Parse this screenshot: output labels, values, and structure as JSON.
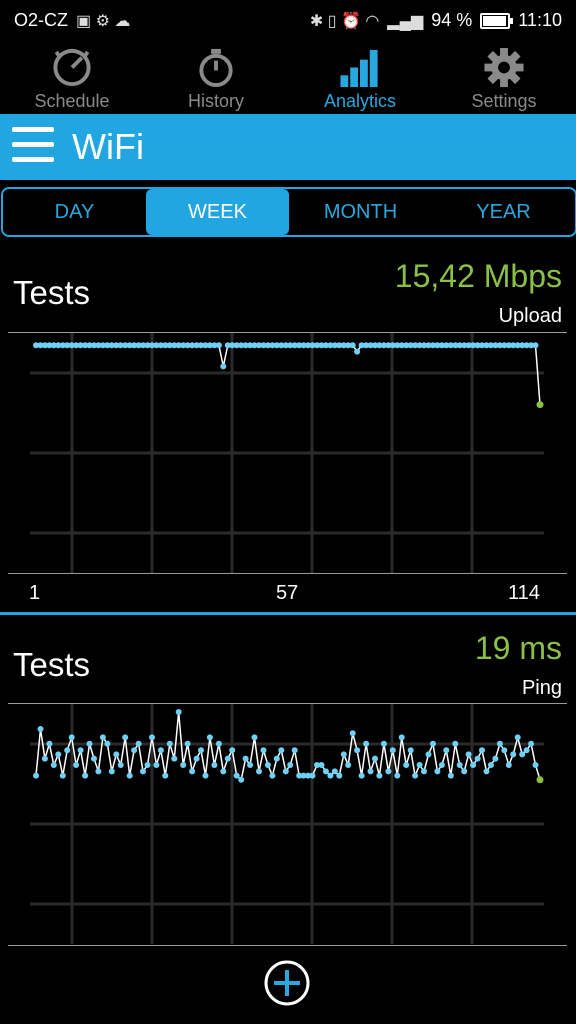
{
  "status_bar": {
    "carrier": "O2-CZ",
    "battery_pct": "94 %",
    "time": "11:10"
  },
  "tabs": [
    {
      "label": "Schedule",
      "icon": "schedule-icon"
    },
    {
      "label": "History",
      "icon": "stopwatch-icon"
    },
    {
      "label": "Analytics",
      "icon": "bar-chart-icon",
      "active": true
    },
    {
      "label": "Settings",
      "icon": "gear-icon"
    }
  ],
  "header": {
    "title": "WiFi"
  },
  "periods": [
    {
      "label": "DAY"
    },
    {
      "label": "WEEK",
      "selected": true
    },
    {
      "label": "MONTH"
    },
    {
      "label": "YEAR"
    }
  ],
  "upload_panel": {
    "title": "Tests",
    "value": "15,42 Mbps",
    "subtitle": "Upload",
    "x_ticks": [
      "1",
      "57",
      "114"
    ]
  },
  "ping_panel": {
    "title": "Tests",
    "value": "19 ms",
    "subtitle": "Ping"
  },
  "colors": {
    "accent": "#22a6e1",
    "value_green": "#8ac046",
    "point": "#6fd0f5"
  },
  "chart_data": [
    {
      "type": "line",
      "series": [
        {
          "values": [
            2,
            2,
            2,
            2,
            2,
            2,
            2,
            2,
            2,
            2,
            2,
            2,
            2,
            2,
            2,
            2,
            2,
            2,
            2,
            2,
            2,
            2,
            2,
            2,
            2,
            2,
            2,
            2,
            2,
            2,
            2,
            2,
            2,
            2,
            2,
            2,
            2,
            2,
            2,
            2,
            2,
            2,
            12,
            2,
            2,
            2,
            2,
            2,
            2,
            2,
            2,
            2,
            2,
            2,
            2,
            2,
            2,
            2,
            2,
            2,
            2,
            2,
            2,
            2,
            2,
            2,
            2,
            2,
            2,
            2,
            2,
            2,
            5,
            2,
            2,
            2,
            2,
            2,
            2,
            2,
            2,
            2,
            2,
            2,
            2,
            2,
            2,
            2,
            2,
            2,
            2,
            2,
            2,
            2,
            2,
            2,
            2,
            2,
            2,
            2,
            2,
            2,
            2,
            2,
            2,
            2,
            2,
            2,
            2,
            2,
            2,
            2,
            2,
            30
          ]
        }
      ],
      "x_count": 114,
      "ylim": [
        0,
        100
      ],
      "grid": true
    },
    {
      "type": "line",
      "series": [
        {
          "values": [
            30,
            8,
            22,
            15,
            25,
            20,
            30,
            18,
            12,
            25,
            18,
            30,
            15,
            22,
            28,
            12,
            15,
            28,
            20,
            25,
            12,
            30,
            18,
            15,
            28,
            25,
            12,
            25,
            18,
            30,
            15,
            22,
            0,
            25,
            15,
            28,
            22,
            18,
            30,
            12,
            25,
            15,
            28,
            22,
            18,
            30,
            32,
            22,
            25,
            12,
            28,
            18,
            25,
            30,
            22,
            18,
            28,
            25,
            18,
            30,
            30,
            30,
            30,
            25,
            25,
            28,
            30,
            28,
            30,
            20,
            25,
            10,
            18,
            30,
            15,
            28,
            22,
            30,
            15,
            28,
            18,
            30,
            12,
            25,
            18,
            30,
            25,
            28,
            20,
            15,
            28,
            25,
            18,
            30,
            15,
            25,
            28,
            20,
            25,
            22,
            18,
            28,
            25,
            22,
            15,
            18,
            25,
            20,
            12,
            20,
            18,
            15,
            25,
            32
          ]
        }
      ],
      "x_count": 114,
      "ylim": [
        0,
        100
      ],
      "grid": true
    }
  ]
}
